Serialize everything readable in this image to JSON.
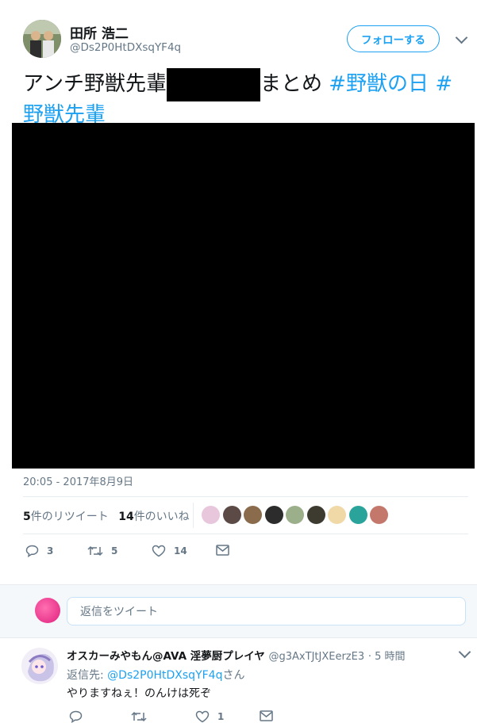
{
  "tweet": {
    "display_name": "田所 浩二",
    "handle": "@Ds2P0HtDXsqYF4q",
    "follow_label": "フォローする",
    "text_before": "アンチ野獣先輩",
    "text_after": "まとめ",
    "hashtag1": "#野獣の日",
    "hashtag2": "#野獣先輩",
    "timestamp": "20:05 - 2017年8月9日",
    "retweet_count": "5",
    "retweet_label": "件のリツイート",
    "like_count": "14",
    "like_label": "件のいいね",
    "actions": {
      "replies": "3",
      "retweets": "5",
      "likes": "14"
    },
    "liker_colors": [
      "#e8c7dd",
      "#5b4a45",
      "#8a6b4c",
      "#2c2c2c",
      "#9bb08a",
      "#3d3a30",
      "#f1d9a7",
      "#2aa39b",
      "#c4786c"
    ]
  },
  "reply_box": {
    "placeholder": "返信をツイート"
  },
  "reply": {
    "display_name": "オスカーみやもん@AVA 淫夢厨プレイヤ",
    "handle": "@g3AxTJtJXEerzE3",
    "time": "· 5 時間",
    "replying_to_prefix": "返信先:",
    "replying_to_handle": "@Ds2P0HtDXsqYF4q",
    "replying_to_suffix": "さん",
    "text": "やりますねぇ！のんけは死ぞ",
    "actions": {
      "likes": "1"
    }
  },
  "colors": {
    "accent": "#1da1f2",
    "muted": "#657786"
  }
}
